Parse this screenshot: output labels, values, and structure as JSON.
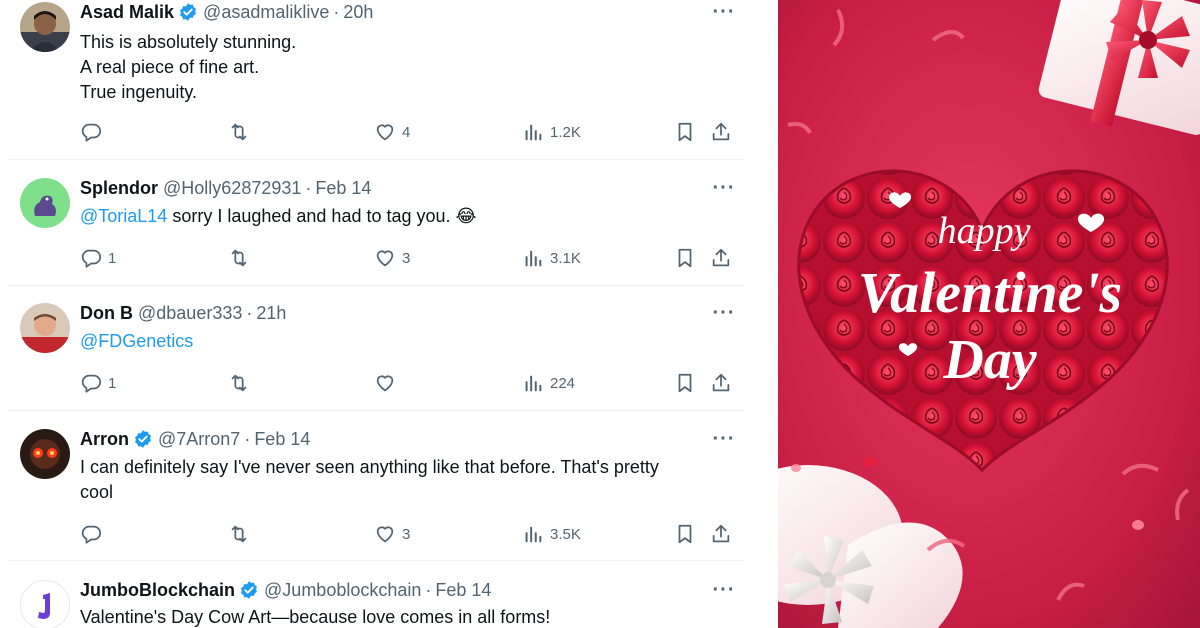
{
  "tweets": [
    {
      "name": "Asad Malik",
      "verified": true,
      "handle": "@asadmaliklive",
      "sep": "·",
      "time": "20h",
      "lines": [
        "This is absolutely stunning.",
        "A real piece of fine art.",
        "True ingenuity."
      ],
      "replies": "",
      "retweets": "",
      "likes": "4",
      "views": "1.2K"
    },
    {
      "name": "Splendor",
      "verified": false,
      "handle": "@Holly62872931",
      "sep": "·",
      "time": "Feb 14",
      "mention": "@ToriaL14",
      "text": " sorry I laughed and had to tag you. 😂",
      "replies": "1",
      "retweets": "",
      "likes": "3",
      "views": "3.1K"
    },
    {
      "name": "Don B",
      "verified": false,
      "handle": "@dbauer333",
      "sep": "·",
      "time": "21h",
      "mention": "@FDGenetics",
      "replies": "1",
      "retweets": "",
      "likes": "",
      "views": "224"
    },
    {
      "name": "Arron",
      "verified": true,
      "handle": "@7Arron7",
      "sep": "·",
      "time": "Feb 14",
      "lines": [
        "I can definitely say I've never seen anything like that before. That's pretty",
        "cool"
      ],
      "replies": "",
      "retweets": "",
      "likes": "3",
      "views": "3.5K"
    },
    {
      "name": "JumboBlockchain",
      "verified": true,
      "handle": "@Jumboblockchain",
      "sep": "·",
      "time": "Feb 14",
      "lines": [
        "Valentine's Day Cow Art—because love comes in all forms!"
      ]
    }
  ],
  "more_label": "···",
  "artwork": {
    "line1": "happy",
    "line2": "Valentine's",
    "line3": "Day"
  },
  "colors": {
    "link": "#1d9bf0",
    "secondary_text": "#536471",
    "background_red": "#d4244a",
    "rose": "#c8102e"
  }
}
